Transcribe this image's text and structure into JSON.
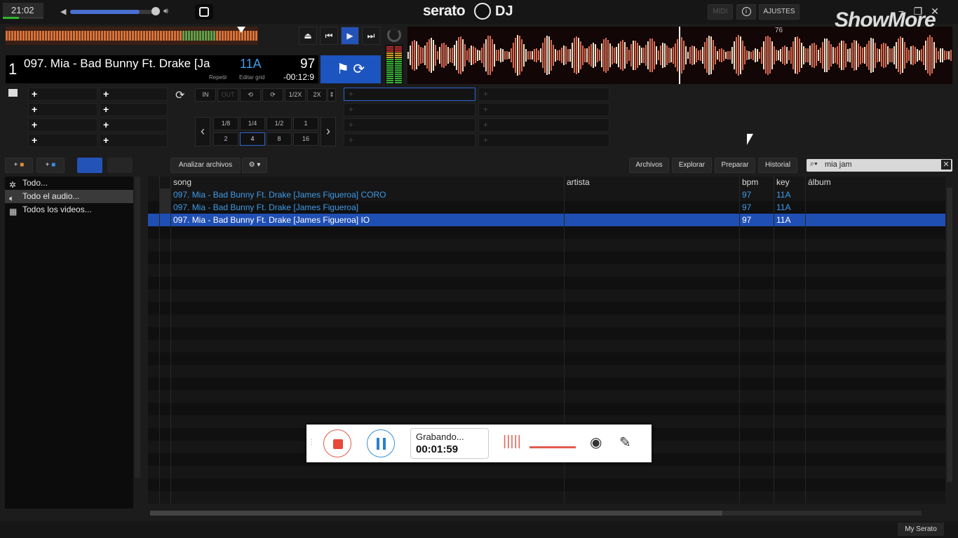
{
  "topbar": {
    "clock": "21:02",
    "volume_level": 0.8,
    "logo": "serato",
    "logo_dj": "DJ",
    "midi": "MIDI",
    "info": "i",
    "settings": "AJUSTES",
    "watermark": "ShowMore"
  },
  "deck": {
    "number": "1",
    "title": "097. Mia - Bad Bunny Ft. Drake [Ja",
    "key": "11A",
    "bpm": "97",
    "repeat_label": "Repetir",
    "grid_label": "Editar grid",
    "time_remaining": "-00:12:9",
    "beat_marker": "76",
    "loop_in": "IN",
    "loop_out": "OUT",
    "half": "1/2X",
    "double": "2X",
    "loop_sizes_top": [
      "1/8",
      "1/4",
      "1/2",
      "1"
    ],
    "loop_sizes_bottom": [
      "2",
      "4",
      "8",
      "16"
    ],
    "selected_loop": "4",
    "cue_plus": "+"
  },
  "library": {
    "analyze": "Analizar archivos",
    "tabs": [
      "Archivos",
      "Explorar",
      "Preparar",
      "Historial"
    ],
    "search_value": "mia jam",
    "sidebar": [
      {
        "label": "Todo...",
        "icon": "star-icon"
      },
      {
        "label": "Todo el audio...",
        "icon": "speaker-icon"
      },
      {
        "label": "Todos los videos...",
        "icon": "film-icon"
      }
    ],
    "columns": {
      "song": "song",
      "artist": "artista",
      "bpm": "bpm",
      "key": "key",
      "album": "álbum"
    },
    "tracks": [
      {
        "song": "097. Mia - Bad Bunny Ft. Drake [James Figueroa] CORO",
        "artist": "",
        "bpm": "97",
        "key": "11A",
        "album": ""
      },
      {
        "song": "097. Mia - Bad Bunny Ft. Drake [James Figueroa]",
        "artist": "",
        "bpm": "97",
        "key": "11A",
        "album": ""
      },
      {
        "song": "097. Mia - Bad Bunny Ft. Drake [James Figueroa] IO",
        "artist": "",
        "bpm": "97",
        "key": "11A",
        "album": ""
      }
    ],
    "selected_index": 2
  },
  "recorder": {
    "status": "Grabando...",
    "time": "00:01:59"
  },
  "statusbar": {
    "my_serato": "My Serato"
  },
  "colors": {
    "accent": "#1f4fb3",
    "track_text": "#3f9ae8",
    "rec_red": "#e8493a",
    "rec_blue": "#2b7fd0"
  }
}
